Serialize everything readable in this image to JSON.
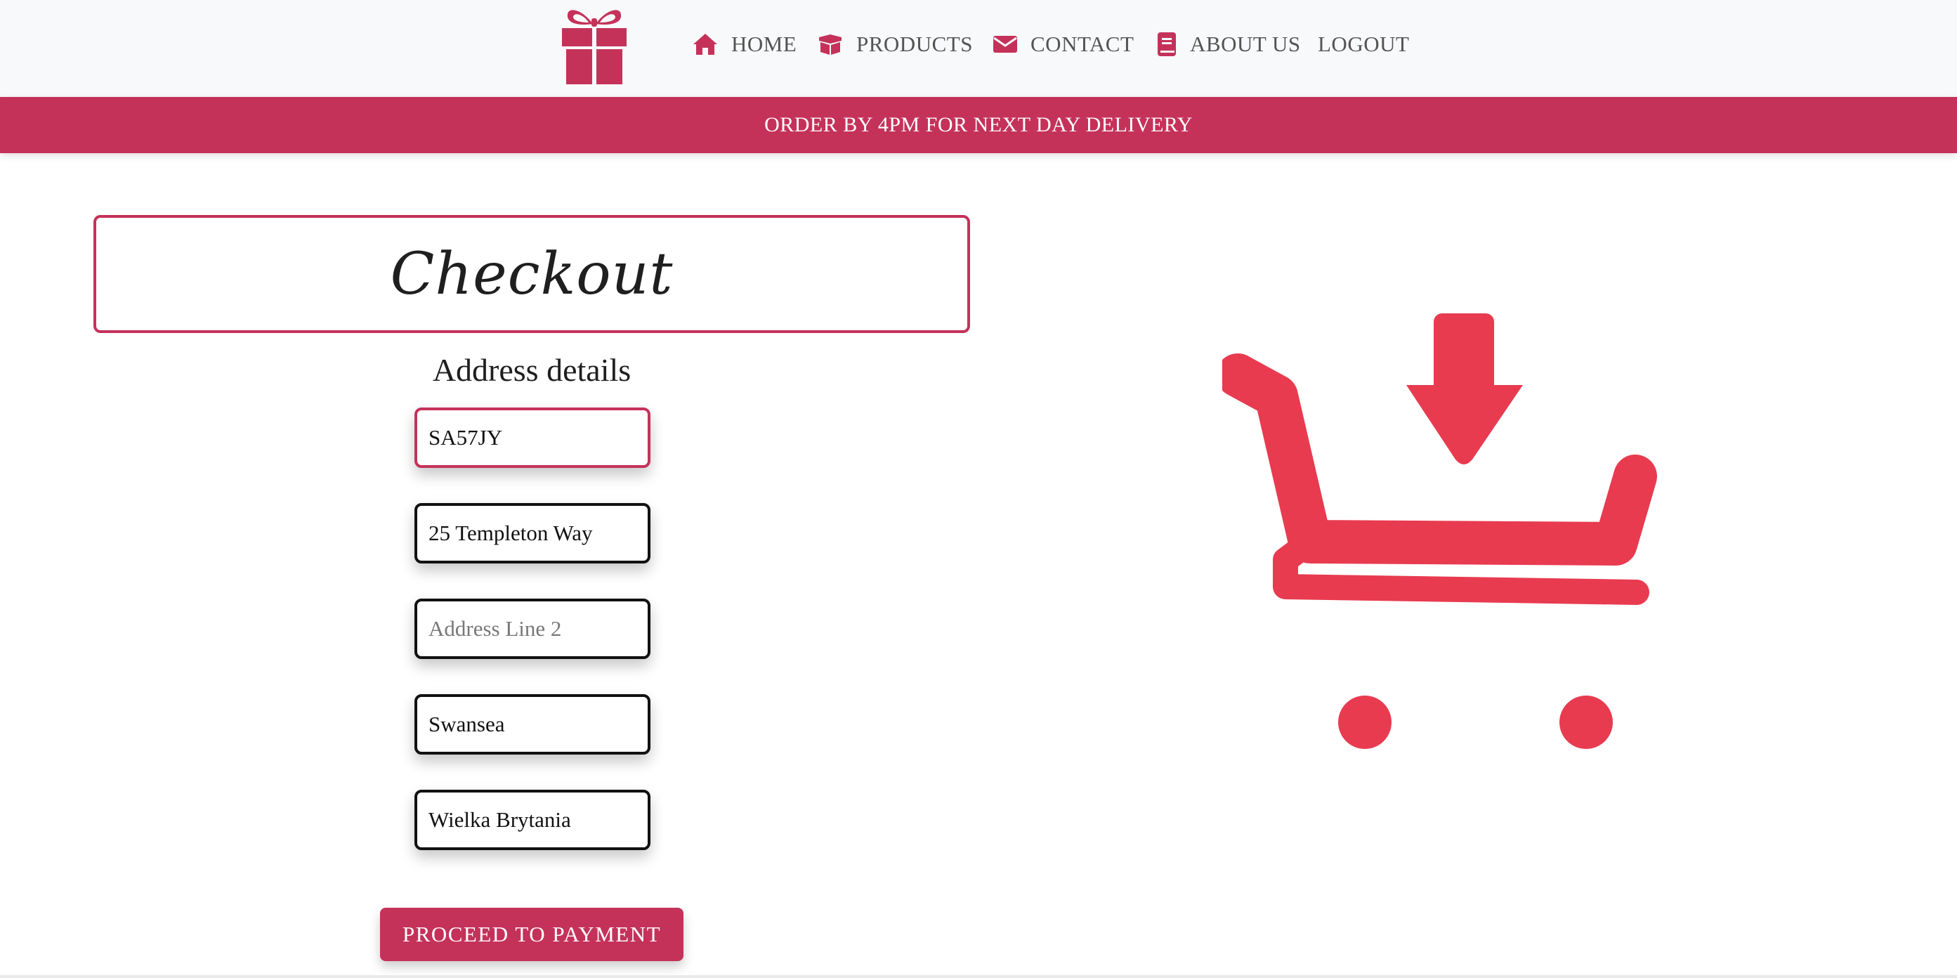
{
  "nav": {
    "items": [
      {
        "label": "HOME",
        "icon": "home-icon"
      },
      {
        "label": "PRODUCTS",
        "icon": "box-icon"
      },
      {
        "label": "CONTACT",
        "icon": "envelope-icon"
      },
      {
        "label": "ABOUT US",
        "icon": "book-icon"
      },
      {
        "label": "LOGOUT"
      }
    ],
    "logo_icon": "gift-icon"
  },
  "banner": {
    "text": "ORDER BY 4PM FOR NEXT DAY DELIVERY"
  },
  "checkout": {
    "title": "Checkout"
  },
  "address": {
    "heading": "Address details",
    "postcode": {
      "value": "SA57JY"
    },
    "line1": {
      "value": "25 Templeton Way"
    },
    "line2": {
      "value": "",
      "placeholder": "Address Line 2"
    },
    "city": {
      "value": "Swansea"
    },
    "country": {
      "value": "Wielka Brytania"
    }
  },
  "actions": {
    "proceed_label": "PROCEED TO PAYMENT"
  },
  "illustration": {
    "icon": "cart-download-icon"
  },
  "colors": {
    "brand": "#c4325a",
    "cart": "#e83b50",
    "nav_bg": "#f8f9fa",
    "nav_text": "#545454"
  }
}
